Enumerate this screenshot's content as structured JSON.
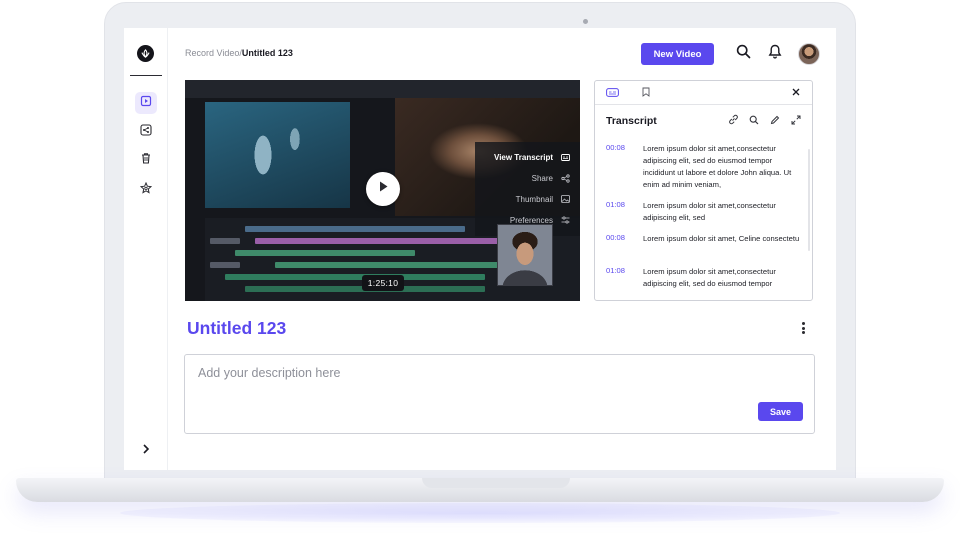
{
  "breadcrumb": {
    "parent": "Record Video",
    "separator": "/",
    "current": "Untitled 123"
  },
  "header": {
    "new_video_label": "New Video",
    "icons": [
      "search-icon",
      "bell-icon",
      "avatar"
    ]
  },
  "sidebar": {
    "items": [
      "video-icon",
      "share-icon",
      "trash-icon",
      "star-icon"
    ],
    "active": "video-icon",
    "expand_icon": "chevron-right-icon"
  },
  "video": {
    "timestamp": "1:25:10",
    "menu": [
      {
        "label": "View Transcript",
        "icon": "caption-icon"
      },
      {
        "label": "Share",
        "icon": "share-icon"
      },
      {
        "label": "Thumbnail",
        "icon": "image-icon"
      },
      {
        "label": "Preferences",
        "icon": "sliders-icon"
      }
    ]
  },
  "transcript": {
    "title": "Transcript",
    "tabs": [
      "caption-icon",
      "bookmark-icon"
    ],
    "tools": [
      "link-icon",
      "search-icon",
      "edit-icon",
      "expand-icon"
    ],
    "entries": [
      {
        "time": "00:08",
        "text": "Lorem ipsum dolor sit amet,consectetur adipiscing elit, sed do eiusmod tempor incididunt ut labore et dolore John aliqua. Ut enim ad minim veniam,"
      },
      {
        "time": "01:08",
        "text": "Lorem ipsum dolor sit amet,consectetur adipiscing elit, sed"
      },
      {
        "time": "00:08",
        "text": "Lorem ipsum dolor sit amet, Celine consectetu"
      },
      {
        "time": "01:08",
        "text": "Lorem ipsum dolor sit amet,consectetur adipiscing elit, sed do eiusmod tempor"
      }
    ]
  },
  "page": {
    "title": "Untitled 123"
  },
  "description": {
    "placeholder": "Add your description here",
    "value": "",
    "save_label": "Save"
  },
  "colors": {
    "accent": "#5a48ee",
    "text": "#1a1a22",
    "muted": "#8a8c95"
  }
}
